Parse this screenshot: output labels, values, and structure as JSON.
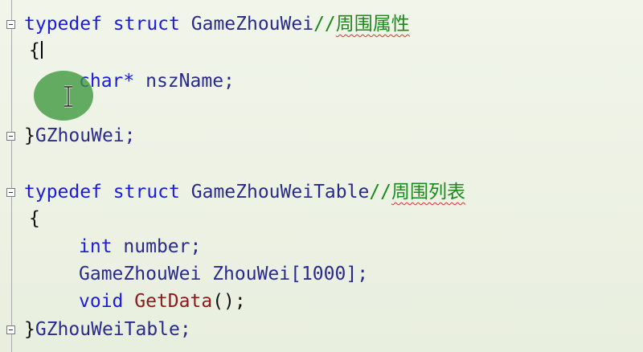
{
  "code": {
    "line1": {
      "kw1": "typedef",
      "kw2": "struct",
      "name": "GameZhouWei",
      "slashes": "//",
      "comment": "周围属性"
    },
    "line2": {
      "brace": "{"
    },
    "line3": {
      "type": "char*",
      "ident": "nszName;"
    },
    "line4": {
      "brace": "}",
      "ident": "GZhouWei;"
    },
    "line5": {
      "kw1": "typedef",
      "kw2": "struct",
      "name": "GameZhouWeiTable",
      "slashes": "//",
      "comment": "周围列表"
    },
    "line6": {
      "brace": "{"
    },
    "line7": {
      "type": "int",
      "ident": "number;"
    },
    "line8": {
      "type": "GameZhouWei",
      "ident": "ZhouWei[1000];"
    },
    "line9": {
      "type": "void",
      "func": "GetData",
      "rest": "();"
    },
    "line10": {
      "brace": "}",
      "ident": "GZhouWeiTable;"
    }
  },
  "icons": {
    "fold": "collapse-minus-icon",
    "cursor": "ibeam-cursor-icon"
  },
  "colors": {
    "keyword": "#1a1ae0",
    "comment": "#1a8a1a",
    "function": "#8b1a1a",
    "background": "#eef3e6"
  }
}
